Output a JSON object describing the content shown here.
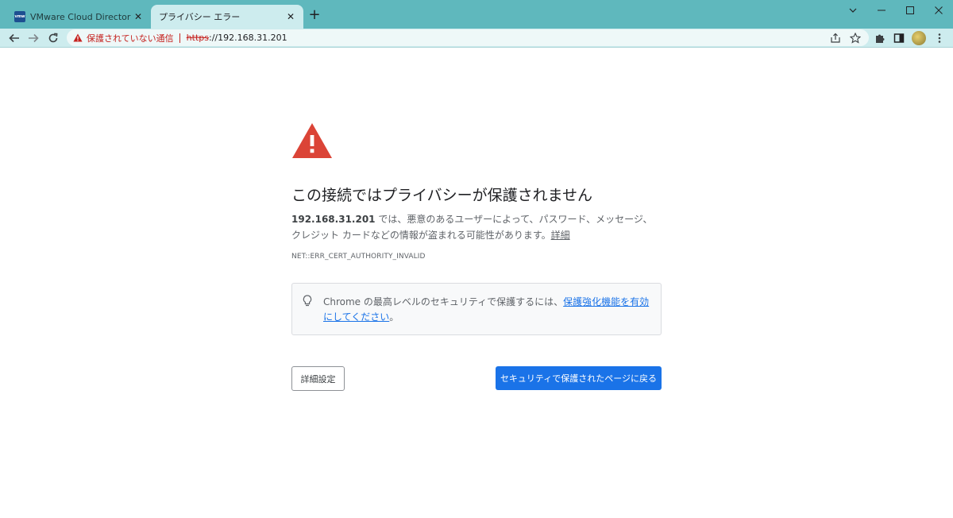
{
  "browser": {
    "tabs": [
      {
        "title": "VMware Cloud Director - 仮想マシン",
        "favicon_text": "vmw",
        "active": false
      },
      {
        "title": "プライバシー エラー",
        "active": true
      }
    ],
    "new_tab_symbol": "+",
    "address_bar": {
      "security_label": "保護されていない通信",
      "url_scheme": "https",
      "url_rest": "://192.168.31.201"
    },
    "icons": {
      "back": "arrow-left-icon",
      "forward": "arrow-right-icon",
      "reload": "reload-icon",
      "share": "share-icon",
      "bookmark": "star-icon",
      "extensions": "puzzle-icon",
      "side_panel": "side-panel-icon",
      "menu": "kebab-menu-icon"
    }
  },
  "page": {
    "heading": "この接続ではプライバシーが保護されません",
    "description": {
      "host": "192.168.31.201",
      "text": " では、悪意のあるユーザーによって、パスワード、メッセージ、クレジット カードなどの情報が盗まれる可能性があります。",
      "link": "詳細"
    },
    "error_code": "NET::ERR_CERT_AUTHORITY_INVALID",
    "tip": {
      "text": "Chrome の最高レベルのセキュリティで保護するには、",
      "link": "保護強化機能を有効にしてください",
      "suffix": "。"
    },
    "buttons": {
      "details": "詳細設定",
      "back_to_safety": "セキュリティで保護されたページに戻る"
    }
  },
  "colors": {
    "tabstrip": "#5fb8bd",
    "toolbar": "#cdecee",
    "warning_red": "#db4437",
    "primary_blue": "#1a73e8"
  }
}
